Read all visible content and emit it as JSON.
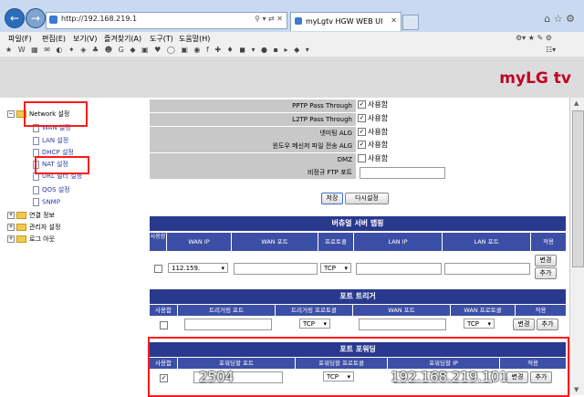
{
  "browser": {
    "url": "http://192.168.219.1",
    "tab_title": "myLgtv HGW WEB UI",
    "menu": [
      "파일(F)",
      "편집(E)",
      "보기(V)",
      "즐겨찾기(A)",
      "도구(T)",
      "도움말(H)"
    ]
  },
  "header": {
    "logo": "myLG tv"
  },
  "sidebar": {
    "network": "Network 설정",
    "items": [
      "WAN 설정",
      "LAN 설정",
      "DHCP 설정",
      "NAT 설정",
      "URL 필터 설정",
      "QOS 설정",
      "SNMP"
    ],
    "groups": [
      "연결 정보",
      "관리자 설정",
      "로그 아웃"
    ]
  },
  "settings": {
    "rows": [
      {
        "label": "PPTP Pass Through",
        "value": "사용함",
        "checked": true
      },
      {
        "label": "L2TP Pass Through",
        "value": "사용함",
        "checked": true
      },
      {
        "label": "넷미팅 ALG",
        "value": "사용함",
        "checked": true
      },
      {
        "label": "윈도우 메신저 파일 전송 ALG",
        "value": "사용함",
        "checked": true
      },
      {
        "label": "DMZ",
        "value": "사용함",
        "checked": false
      },
      {
        "label": "비정규 FTP 포트",
        "value": "",
        "checked": false
      }
    ],
    "save": "저장",
    "reset": "다시설정"
  },
  "virtual_server": {
    "title": "버츄얼 서버 맵핑",
    "headers": [
      "사용함",
      "WAN IP",
      "WAN 포트",
      "프로토콜",
      "LAN IP",
      "LAN 포트",
      "적용"
    ],
    "wan_ip": "112.159.",
    "protocol": "TCP",
    "change": "변경",
    "add": "추가"
  },
  "port_trigger": {
    "title": "포트 트리거",
    "headers": [
      "사용함",
      "트리거링 포트",
      "트리거링 프로토콜",
      "WAN 포트",
      "WAN 프로토콜",
      "적용"
    ],
    "protocol1": "TCP",
    "protocol2": "TCP",
    "change": "변경",
    "add": "추가"
  },
  "port_forwarding": {
    "title": "포트 포워딩",
    "headers": [
      "사용함",
      "포워딩할 포트",
      "포워딩할 프로토콜",
      "포워딩할 IP",
      "적용"
    ],
    "port": "2504",
    "protocol": "TCP",
    "ip": "192.168.219.101",
    "change": "변경",
    "add": "추가"
  }
}
